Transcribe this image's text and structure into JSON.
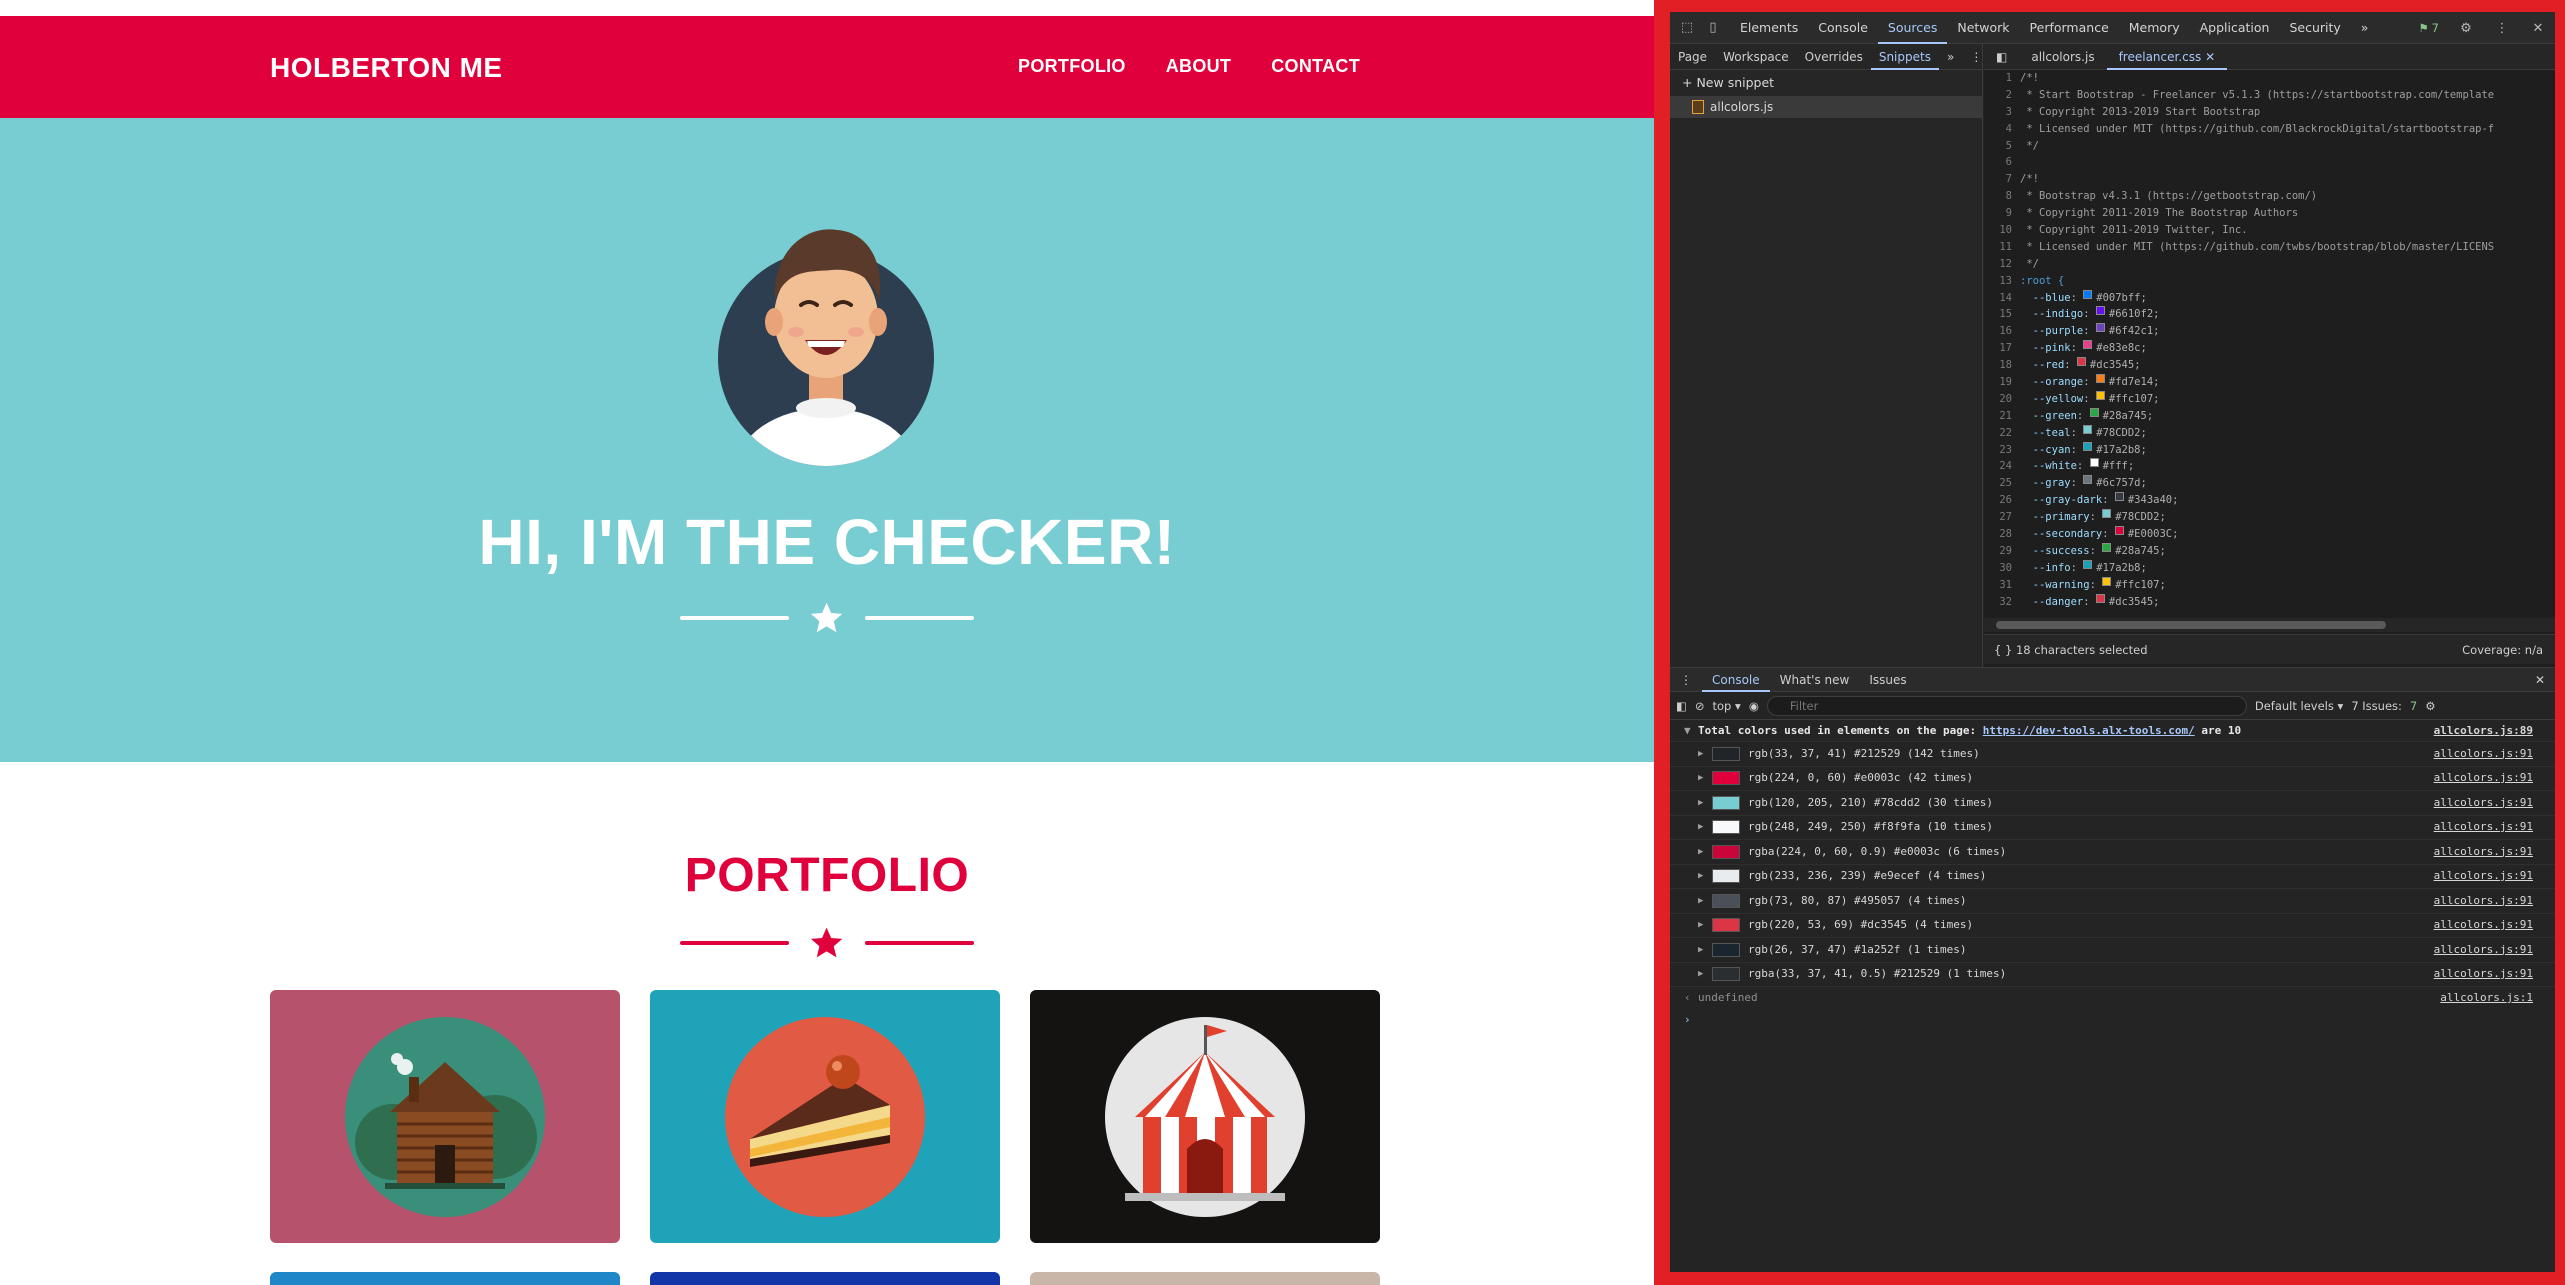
{
  "site": {
    "brand": "HOLBERTON ME",
    "nav": [
      "PORTFOLIO",
      "ABOUT",
      "CONTACT"
    ],
    "hero_title": "HI, I'M THE CHECKER!",
    "portfolio_title": "PORTFOLIO",
    "cards": [
      "cabin",
      "cake",
      "circus"
    ],
    "colors": {
      "primary": "#e0003c",
      "teal": "#78cdd2"
    }
  },
  "devtools": {
    "panels": [
      "Elements",
      "Console",
      "Sources",
      "Network",
      "Performance",
      "Memory",
      "Application",
      "Security"
    ],
    "more_panels": "»",
    "issues_count": "7",
    "sources_nav_tabs": [
      "Page",
      "Workspace",
      "Overrides",
      "Snippets"
    ],
    "new_snippet": "New snippet",
    "snippet_file": "allcolors.js",
    "editor_tabs": [
      "allcolors.js",
      "freelancer.css"
    ],
    "code_lines": [
      {
        "n": "1",
        "t": "/*!"
      },
      {
        "n": "2",
        "t": " * Start Bootstrap - Freelancer v5.1.3 (https://startbootstrap.com/template"
      },
      {
        "n": "3",
        "t": " * Copyright 2013-2019 Start Bootstrap"
      },
      {
        "n": "4",
        "t": " * Licensed under MIT (https://github.com/BlackrockDigital/startbootstrap-f"
      },
      {
        "n": "5",
        "t": " */"
      },
      {
        "n": "6",
        "t": ""
      },
      {
        "n": "7",
        "t": "/*!"
      },
      {
        "n": "8",
        "t": " * Bootstrap v4.3.1 (https://getbootstrap.com/)"
      },
      {
        "n": "9",
        "t": " * Copyright 2011-2019 The Bootstrap Authors"
      },
      {
        "n": "10",
        "t": " * Copyright 2011-2019 Twitter, Inc."
      },
      {
        "n": "11",
        "t": " * Licensed under MIT (https://github.com/twbs/bootstrap/blob/master/LICENS"
      },
      {
        "n": "12",
        "t": " */"
      },
      {
        "n": "13",
        "t": ":root {"
      }
    ],
    "css_vars": [
      {
        "n": "14",
        "name": "--blue",
        "value": "#007bff"
      },
      {
        "n": "15",
        "name": "--indigo",
        "value": "#6610f2"
      },
      {
        "n": "16",
        "name": "--purple",
        "value": "#6f42c1"
      },
      {
        "n": "17",
        "name": "--pink",
        "value": "#e83e8c"
      },
      {
        "n": "18",
        "name": "--red",
        "value": "#dc3545"
      },
      {
        "n": "19",
        "name": "--orange",
        "value": "#fd7e14"
      },
      {
        "n": "20",
        "name": "--yellow",
        "value": "#ffc107"
      },
      {
        "n": "21",
        "name": "--green",
        "value": "#28a745"
      },
      {
        "n": "22",
        "name": "--teal",
        "value": "#78CDD2"
      },
      {
        "n": "23",
        "name": "--cyan",
        "value": "#17a2b8"
      },
      {
        "n": "24",
        "name": "--white",
        "value": "#fff"
      },
      {
        "n": "25",
        "name": "--gray",
        "value": "#6c757d"
      },
      {
        "n": "26",
        "name": "--gray-dark",
        "value": "#343a40"
      },
      {
        "n": "27",
        "name": "--primary",
        "value": "#78CDD2"
      },
      {
        "n": "28",
        "name": "--secondary",
        "value": "#E0003C"
      },
      {
        "n": "29",
        "name": "--success",
        "value": "#28a745"
      },
      {
        "n": "30",
        "name": "--info",
        "value": "#17a2b8"
      },
      {
        "n": "31",
        "name": "--warning",
        "value": "#ffc107"
      },
      {
        "n": "32",
        "name": "--danger",
        "value": "#dc3545"
      }
    ],
    "editor_status_left": "18 characters selected",
    "editor_status_right": "Coverage: n/a",
    "drawer_tabs": [
      "Console",
      "What's new",
      "Issues"
    ],
    "console_context": "top",
    "filter_placeholder": "Filter",
    "levels": "Default levels",
    "issues_label": "7 Issues:",
    "console_header": {
      "text_before": "Total colors used in elements on the page: ",
      "link": "https://dev-tools.alx-tools.com/",
      "text_after": " are 10",
      "source": "allcolors.js:89"
    },
    "color_rows": [
      {
        "text": "rgb(33, 37, 41) #212529 (142 times)",
        "hex": "#212529",
        "source": "allcolors.js:91"
      },
      {
        "text": "rgb(224, 0, 60) #e0003c (42 times)",
        "hex": "#e0003c",
        "source": "allcolors.js:91"
      },
      {
        "text": "rgb(120, 205, 210) #78cdd2 (30 times)",
        "hex": "#78cdd2",
        "source": "allcolors.js:91"
      },
      {
        "text": "rgb(248, 249, 250) #f8f9fa (10 times)",
        "hex": "#f8f9fa",
        "source": "allcolors.js:91"
      },
      {
        "text": "rgba(224, 0, 60, 0.9) #e0003c (6 times)",
        "hex": "#c9053a",
        "source": "allcolors.js:91"
      },
      {
        "text": "rgb(233, 236, 239) #e9ecef (4 times)",
        "hex": "#e9ecef",
        "source": "allcolors.js:91"
      },
      {
        "text": "rgb(73, 80, 87) #495057 (4 times)",
        "hex": "#495057",
        "source": "allcolors.js:91"
      },
      {
        "text": "rgb(220, 53, 69) #dc3545 (4 times)",
        "hex": "#dc3545",
        "source": "allcolors.js:91"
      },
      {
        "text": "rgb(26, 37, 47) #1a252f (1 times)",
        "hex": "#1a252f",
        "source": "allcolors.js:91"
      },
      {
        "text": "rgba(33, 37, 41, 0.5) #212529 (1 times)",
        "hex": "#2b2e31",
        "source": "allcolors.js:91"
      }
    ],
    "undefined_text": "undefined",
    "undefined_source": "allcolors.js:1"
  }
}
